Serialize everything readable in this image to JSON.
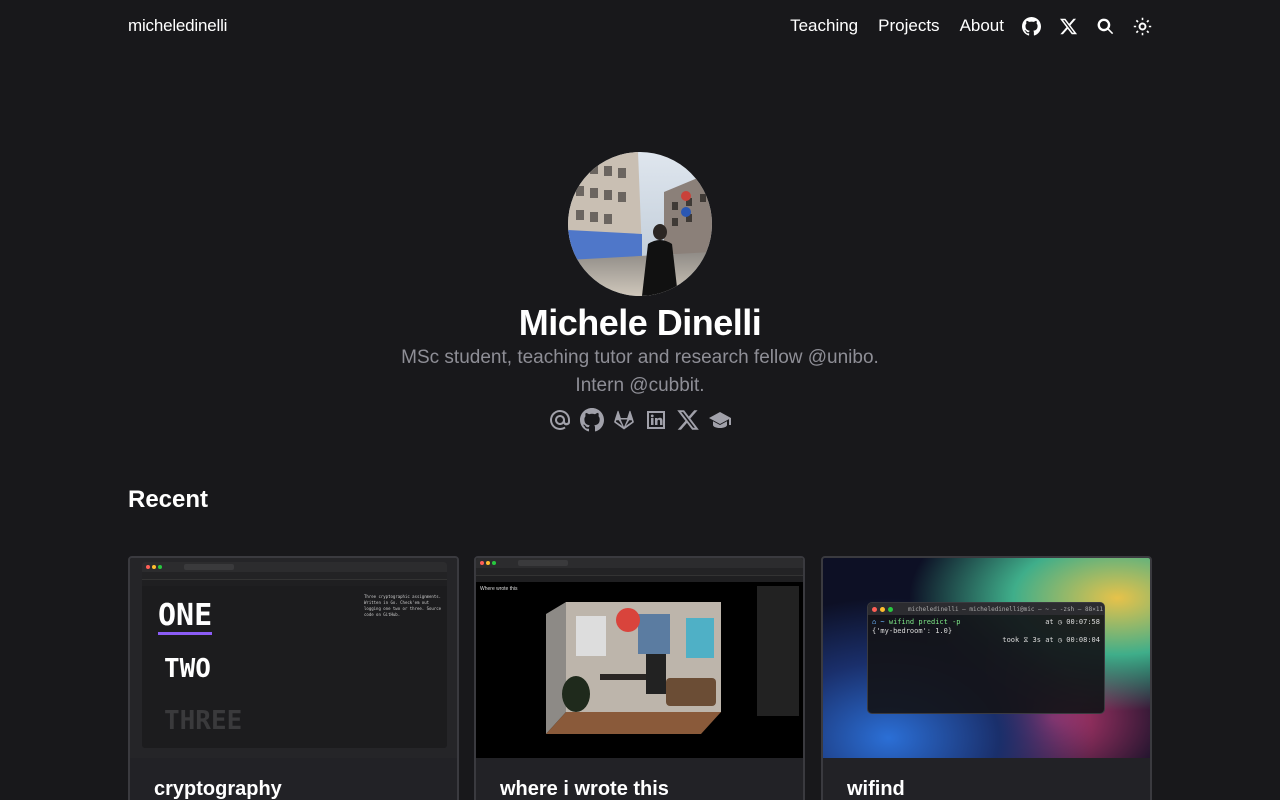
{
  "header": {
    "brand": "micheledinelli",
    "nav": [
      "Teaching",
      "Projects",
      "About"
    ],
    "icons": [
      "github-icon",
      "x-icon",
      "search-icon",
      "theme-toggle-icon"
    ]
  },
  "hero": {
    "name": "Michele Dinelli",
    "bio_line1": "MSc student, teaching tutor and research fellow @unibo.",
    "bio_line2": "Intern @cubbit.",
    "socials": [
      "email-icon",
      "github-icon",
      "gitlab-icon",
      "linkedin-icon",
      "x-icon",
      "scholar-icon"
    ]
  },
  "recent": {
    "title": "Recent",
    "cards": [
      {
        "title": "cryptography",
        "thumb_words": [
          "ONE",
          "TWO",
          "THREE"
        ],
        "thumb_note": "Three cryptographic assignments. Written in Go. Check'em out logging one two or three. Source code on GitHub."
      },
      {
        "title": "where i wrote this",
        "thumb_note": "Where wrote this"
      },
      {
        "title": "wifind",
        "terminal_title": "micheledinelli — micheledinelli@mic — ~ — -zsh — 88×11",
        "terminal_line1_cmd": "wifind predict -p",
        "terminal_line1_time": "at ◷ 00:07:58",
        "terminal_line2": "{'my-bedroom': 1.0}",
        "terminal_line3_took": "took ⧖ 3s at ◷ 00:08:04"
      }
    ]
  },
  "colors": {
    "background": "#18181b",
    "card_background": "#222226",
    "card_border": "#3a3a3f",
    "muted_text": "#8e8e96",
    "accent_underline": "#8b5cf6"
  }
}
